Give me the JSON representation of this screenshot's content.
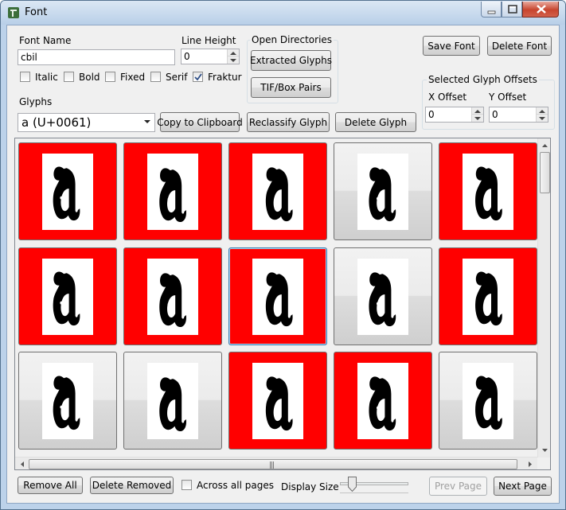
{
  "window": {
    "title": "Font"
  },
  "font_name": {
    "label": "Font Name",
    "value": "cbil"
  },
  "line_height": {
    "label": "Line Height",
    "value": "0"
  },
  "styles": [
    {
      "label": "Italic",
      "checked": false
    },
    {
      "label": "Bold",
      "checked": false
    },
    {
      "label": "Fixed",
      "checked": false
    },
    {
      "label": "Serif",
      "checked": false
    },
    {
      "label": "Fraktur",
      "checked": true
    }
  ],
  "open_directories": {
    "title": "Open Directories",
    "extracted_label": "Extracted Glyphs",
    "tif_label": "TIF/Box Pairs"
  },
  "font_buttons": {
    "save_label": "Save Font",
    "delete_label": "Delete Font"
  },
  "offsets": {
    "title": "Selected Glyph Offsets",
    "x_label": "X Offset",
    "x_value": "0",
    "y_label": "Y Offset",
    "y_value": "0"
  },
  "glyphs": {
    "label": "Glyphs",
    "selected": "a (U+0061)",
    "copy_label": "Copy to Clipboard",
    "reclassify_label": "Reclassify Glyph",
    "delete_label": "Delete Glyph"
  },
  "tiles": [
    {
      "marked": true
    },
    {
      "marked": true
    },
    {
      "marked": true
    },
    {
      "marked": false
    },
    {
      "marked": true
    },
    {
      "marked": true
    },
    {
      "marked": true
    },
    {
      "marked": true,
      "selected": true
    },
    {
      "marked": false
    },
    {
      "marked": true
    },
    {
      "marked": false
    },
    {
      "marked": false
    },
    {
      "marked": true
    },
    {
      "marked": true
    },
    {
      "marked": false
    }
  ],
  "footer": {
    "remove_all_label": "Remove All",
    "delete_removed_label": "Delete Removed",
    "across_pages_label": "Across all pages",
    "across_pages_checked": false,
    "display_size_label": "Display Size",
    "display_size_fraction": 0.15,
    "prev_label": "Prev Page",
    "next_label": "Next Page"
  },
  "colors": {
    "marked": "#ff0000",
    "selection": "#3c7fb1",
    "titlebar": "#bcd2ea"
  }
}
